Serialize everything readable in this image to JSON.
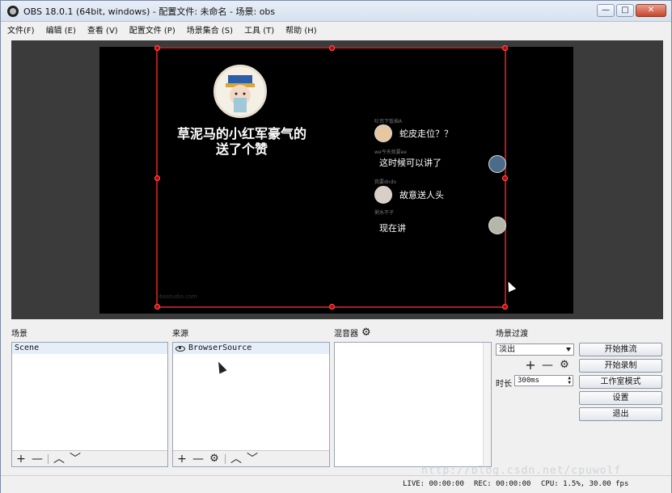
{
  "window": {
    "title": "OBS 18.0.1 (64bit, windows) - 配置文件: 未命名 - 场景: obs",
    "minimize": "—",
    "maximize": "□",
    "close": "✕"
  },
  "menu": [
    "文件(F)",
    "编辑 (E)",
    "查看 (V)",
    "配置文件 (P)",
    "场景集合 (S)",
    "工具 (T)",
    "帮助 (H)"
  ],
  "preview": {
    "gift_text": "草泥马的小红军豪气的\n送了个赞",
    "chat": [
      {
        "name": "吐司下饭插A",
        "msg": "蛇皮走位？？"
      },
      {
        "name": "we今天就要ee",
        "msg": "这时候可以讲了"
      },
      {
        "name": "我要dndo",
        "msg": "故意送人头"
      },
      {
        "name": "粥水不子",
        "msg": "现在讲"
      }
    ],
    "small_watermark": "obsstudio.com"
  },
  "scenes": {
    "title": "场景",
    "items": [
      "Scene"
    ]
  },
  "sources": {
    "title": "来源",
    "items": [
      "BrowserSource"
    ]
  },
  "mixer": {
    "title": "混音器"
  },
  "transitions": {
    "title": "场景过渡",
    "selected": "淡出",
    "duration_label": "时长",
    "duration_value": "300ms"
  },
  "controls": {
    "start_streaming": "开始推流",
    "start_recording": "开始录制",
    "studio_mode": "工作室模式",
    "settings": "设置",
    "exit": "退出"
  },
  "status": {
    "live": "LIVE: 00:00:00",
    "rec": "REC: 00:00:00",
    "cpu": "CPU: 1.5%, 30.00 fps"
  },
  "blog_watermark": "http://blog.csdn.net/cpuwolf",
  "icons": {
    "add": "+",
    "remove": "—",
    "up": "︿",
    "down": "﹀",
    "gear": "⚙",
    "eye": "👁"
  }
}
